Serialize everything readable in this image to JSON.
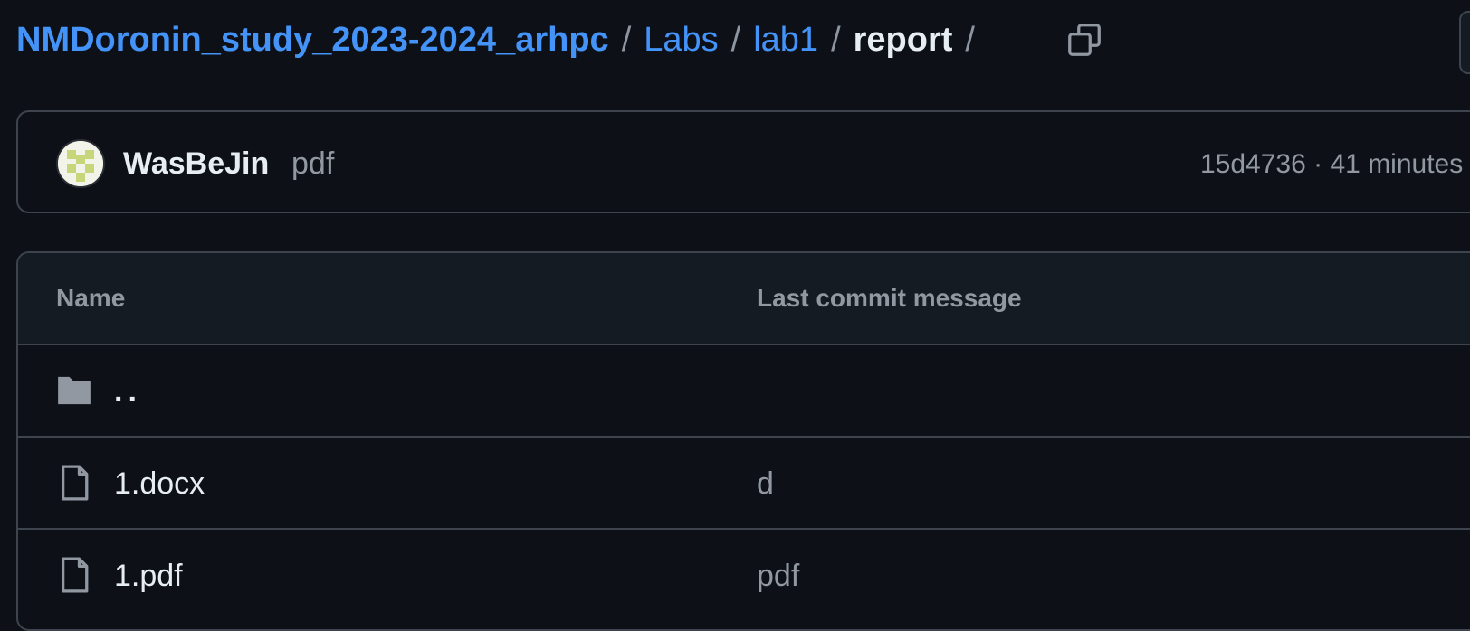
{
  "breadcrumb": {
    "repo": "NMDoronin_study_2023-2024_arhpc",
    "segments": [
      "Labs",
      "lab1"
    ],
    "current": "report",
    "separator": "/"
  },
  "commit": {
    "author": "WasBeJin",
    "message": "pdf",
    "hash": "15d4736",
    "dot": "·",
    "time": "41 minutes"
  },
  "table": {
    "headers": {
      "name": "Name",
      "message": "Last commit message"
    },
    "rows": [
      {
        "name": "..",
        "message": "",
        "icon": "folder-icon"
      },
      {
        "name": "1.docx",
        "message": "d",
        "icon": "file-icon"
      },
      {
        "name": "1.pdf",
        "message": "pdf",
        "icon": "file-icon"
      }
    ]
  },
  "colors": {
    "background": "#0d1117",
    "link": "#4493f8",
    "border": "#3d444d",
    "muted": "#9198a1",
    "text": "#e6edf3"
  }
}
